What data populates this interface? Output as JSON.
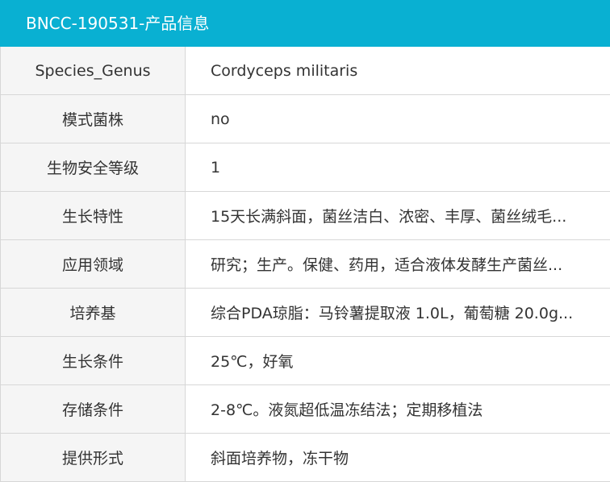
{
  "header": {
    "title": "BNCC-190531-产品信息"
  },
  "rows": [
    {
      "label": "Species_Genus",
      "value": "Cordyceps militaris"
    },
    {
      "label": "模式菌株",
      "value": "no"
    },
    {
      "label": "生物安全等级",
      "value": "1"
    },
    {
      "label": "生长特性",
      "value": "15天长满斜面，菌丝洁白、浓密、丰厚、菌丝绒毛..."
    },
    {
      "label": "应用领域",
      "value": "研究；生产。保健、药用，适合液体发酵生产菌丝..."
    },
    {
      "label": "培养基",
      "value": "综合PDA琼脂：马铃薯提取液 1.0L，葡萄糖 20.0g..."
    },
    {
      "label": "生长条件",
      "value": "25℃，好氧"
    },
    {
      "label": "存储条件",
      "value": "2-8℃。液氮超低温冻结法；定期移植法"
    },
    {
      "label": "提供形式",
      "value": "斜面培养物，冻干物"
    }
  ]
}
